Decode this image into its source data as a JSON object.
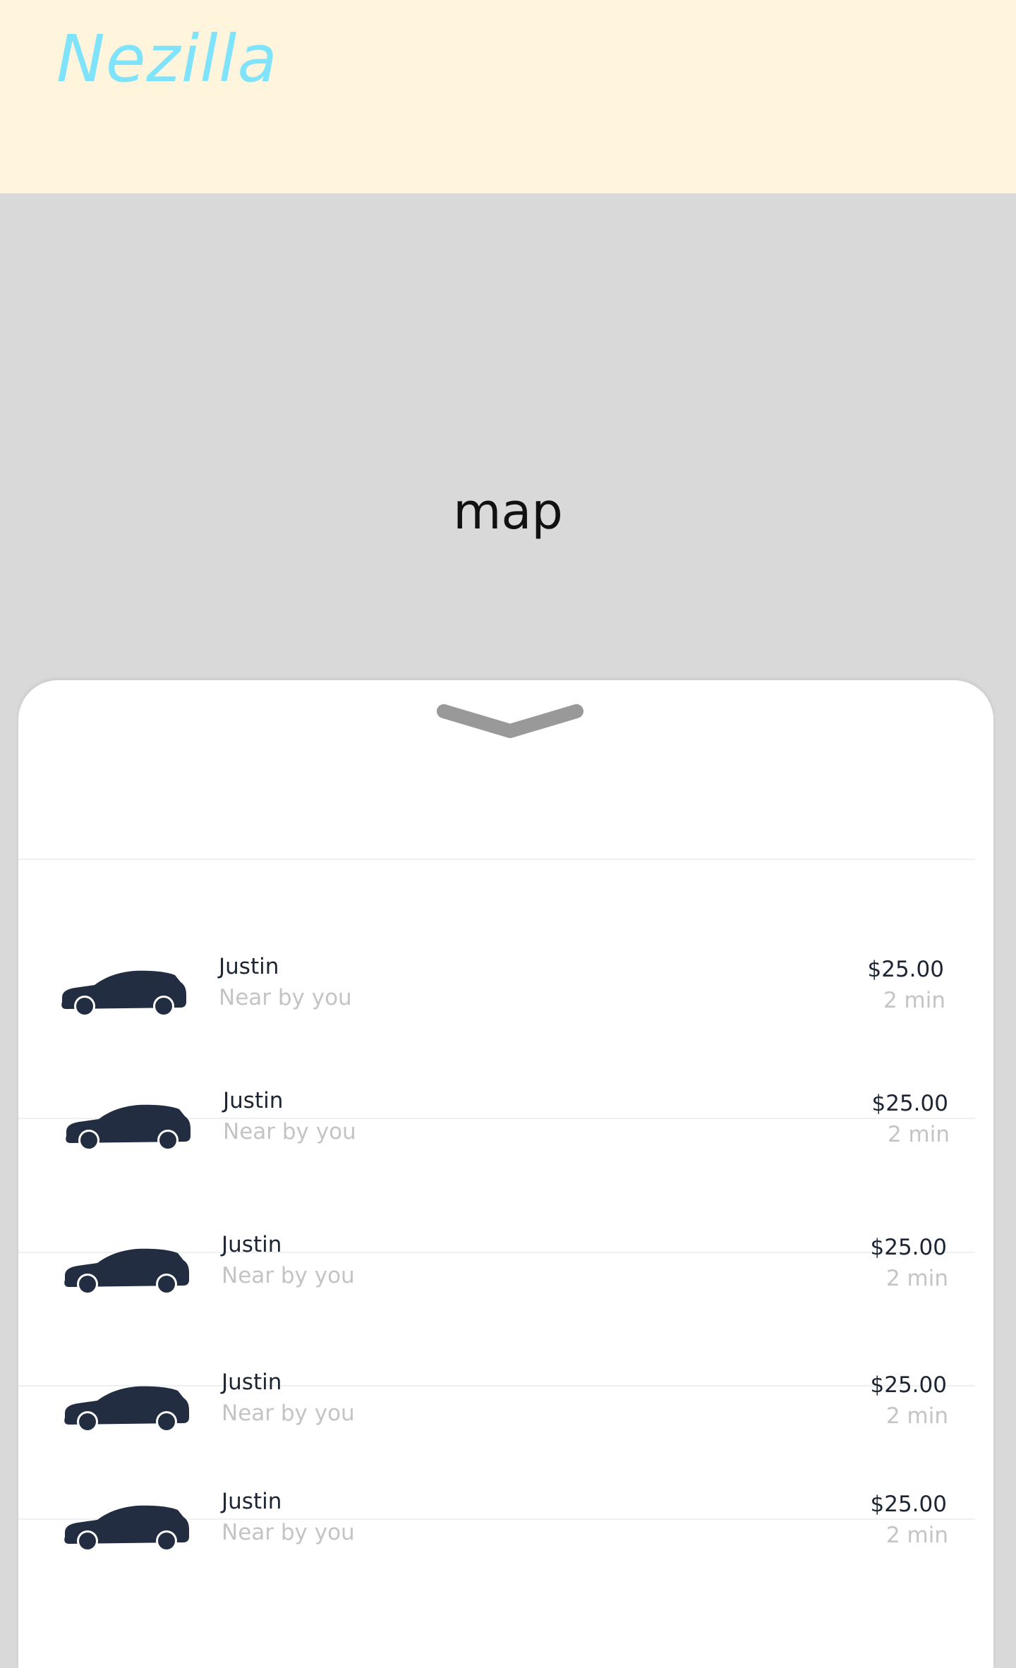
{
  "app": {
    "brand": "Nezilla"
  },
  "map": {
    "label": "map"
  },
  "sheet": {
    "handle_icon": "chevron-down-icon",
    "car_icon": "car-icon",
    "car_color": "#222d42",
    "rides": [
      {
        "name": "Justin",
        "subtitle": "Near by you",
        "price": "$25.00",
        "eta": "2 min"
      },
      {
        "name": "Justin",
        "subtitle": "Near by you",
        "price": "$25.00",
        "eta": "2 min"
      },
      {
        "name": "Justin",
        "subtitle": "Near by you",
        "price": "$25.00",
        "eta": "2 min"
      },
      {
        "name": "Justin",
        "subtitle": "Near by you",
        "price": "$25.00",
        "eta": "2 min"
      },
      {
        "name": "Justin",
        "subtitle": "Near by you",
        "price": "$25.00",
        "eta": "2 min"
      }
    ]
  }
}
